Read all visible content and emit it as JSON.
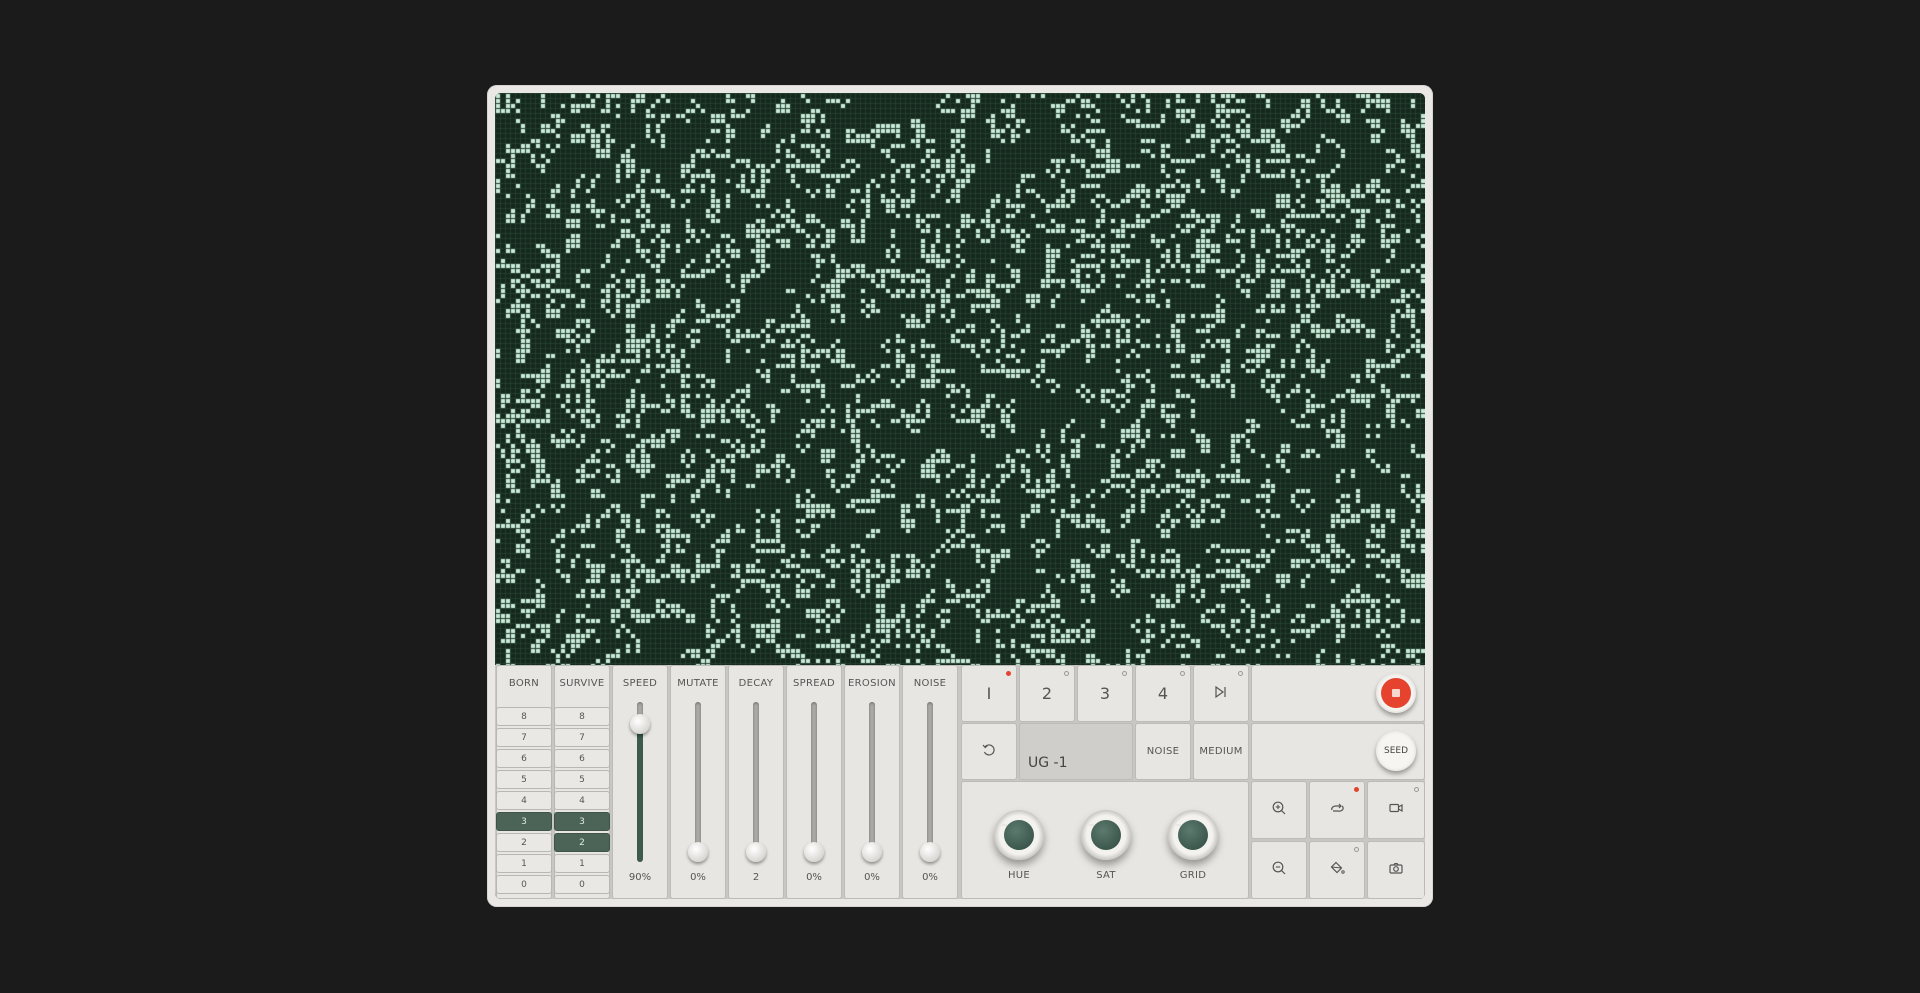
{
  "window": {
    "device_bg": "#e9e8e4",
    "cell_live": "#c9ead8",
    "cell_dead": "#15281d",
    "grid_line": "#2d4a38"
  },
  "rules": {
    "born_label": "BORN",
    "survive_label": "SURVIVE",
    "numbers": [
      "8",
      "7",
      "6",
      "5",
      "4",
      "3",
      "2",
      "1",
      "0"
    ],
    "born_active": [
      "3"
    ],
    "survive_active": [
      "3",
      "2"
    ]
  },
  "sliders": [
    {
      "label": "SPEED",
      "value_text": "90%",
      "value": 0.9,
      "fill": true
    },
    {
      "label": "MUTATE",
      "value_text": "0%",
      "value": 0,
      "fill": false
    },
    {
      "label": "DECAY",
      "value_text": "2",
      "value": 0,
      "fill": false
    },
    {
      "label": "SPREAD",
      "value_text": "0%",
      "value": 0,
      "fill": false
    },
    {
      "label": "EROSION",
      "value_text": "0%",
      "value": 0,
      "fill": false
    },
    {
      "label": "NOISE",
      "value_text": "0%",
      "value": 0,
      "fill": false
    }
  ],
  "patterns": [
    {
      "label": "I",
      "led": "red"
    },
    {
      "label": "2",
      "led": "off"
    },
    {
      "label": "3",
      "led": "off"
    },
    {
      "label": "4",
      "led": "off"
    }
  ],
  "skip_icon": "skip-forward-icon",
  "display": {
    "text": "UG -1"
  },
  "mode_buttons": {
    "noise": "NOISE",
    "medium": "MEDIUM"
  },
  "record_button": {
    "color": "#e5432d"
  },
  "seed_button": {
    "label": "SEED"
  },
  "knobs": [
    {
      "label": "HUE"
    },
    {
      "label": "SAT"
    },
    {
      "label": "GRID"
    }
  ],
  "tools": [
    "zoom-in-icon",
    "loop-icon",
    "video-camera-icon",
    "zoom-out-icon",
    "paint-bucket-icon",
    "camera-icon"
  ]
}
